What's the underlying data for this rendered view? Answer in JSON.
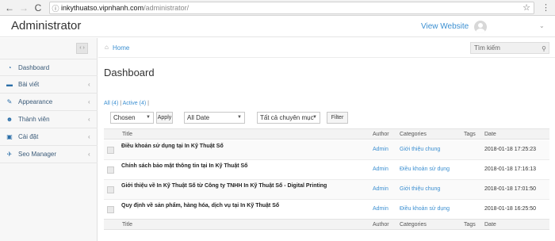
{
  "browser": {
    "back": "←",
    "forward": "→",
    "reload": "C",
    "url_host": "inkythuatso.vipnhanh.com",
    "url_path": "/administrator/"
  },
  "header": {
    "brand": "Administrator",
    "view_website": "View Website"
  },
  "sidebar": {
    "items": [
      {
        "label": "Dashboard",
        "icon": "dashboard-icon",
        "glyph": "◔",
        "has_chevron": false
      },
      {
        "label": "Bài viết",
        "icon": "article-icon",
        "glyph": "▬",
        "has_chevron": true
      },
      {
        "label": "Appearance",
        "icon": "brush-icon",
        "glyph": "✎",
        "has_chevron": true
      },
      {
        "label": "Thành viên",
        "icon": "users-icon",
        "glyph": "☻",
        "has_chevron": true
      },
      {
        "label": "Cài đặt",
        "icon": "settings-icon",
        "glyph": "▣",
        "has_chevron": true
      },
      {
        "label": "Seo Manager",
        "icon": "seo-icon",
        "glyph": "✈",
        "has_chevron": true
      }
    ]
  },
  "breadcrumb": {
    "home": "Home"
  },
  "search": {
    "placeholder": "Tìm kiếm"
  },
  "page": {
    "title": "Dashboard"
  },
  "filters": {
    "all": "All (4)",
    "separator": "|",
    "active": "Active (4)",
    "trailing": "|"
  },
  "controls": {
    "bulk_action": "Chosen",
    "apply": "Apply",
    "date": "All Date",
    "category": "Tất cả chuyên mục",
    "filter": "Filter"
  },
  "table": {
    "columns": {
      "title": "Title",
      "author": "Author",
      "categories": "Categories",
      "tags": "Tags",
      "date": "Date"
    },
    "rows": [
      {
        "title": "Điều khoản sử dụng tại In Kỹ Thuật Số",
        "author": "Admin",
        "category": "Giới thiệu chung",
        "tags": "",
        "date": "2018-01-18 17:25:23"
      },
      {
        "title": "Chính sách bảo mật thông tin tại In Kỹ Thuật Số",
        "author": "Admin",
        "category": "Điều khoản sử dụng",
        "tags": "",
        "date": "2018-01-18 17:16:13"
      },
      {
        "title": "Giới thiệu về In Kỹ Thuật Số từ Công ty TNHH In Kỹ Thuật Số - Digital Printing",
        "author": "Admin",
        "category": "Giới thiệu chung",
        "tags": "",
        "date": "2018-01-18 17:01:50"
      },
      {
        "title": "Quy định về sản phẩm, hàng hóa, dịch vụ tại In Kỹ Thuật Số",
        "author": "Admin",
        "category": "Điều khoản sử dụng",
        "tags": "",
        "date": "2018-01-18 16:25:50"
      }
    ]
  }
}
